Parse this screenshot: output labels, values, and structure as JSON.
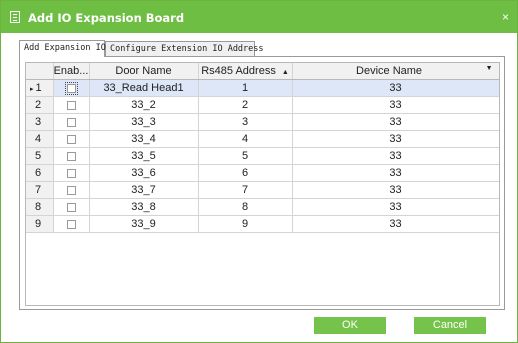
{
  "window": {
    "title": "Add IO Expansion Board",
    "close_label": "×"
  },
  "tabs": [
    {
      "label": "Add Expansion IO",
      "active": true
    },
    {
      "label": "Configure Extension IO Address",
      "active": false
    }
  ],
  "table": {
    "columns": [
      "Enab...",
      "Door Name",
      "Rs485 Address",
      "Device Name"
    ],
    "sort_indicator": "▲",
    "dropdown_indicator": "▼",
    "current_row_indicator": "▸",
    "rows": [
      {
        "num": "1",
        "door_name": "33_Read Head1",
        "address": "1",
        "device": "33",
        "checked": false
      },
      {
        "num": "2",
        "door_name": "33_2",
        "address": "2",
        "device": "33",
        "checked": false
      },
      {
        "num": "3",
        "door_name": "33_3",
        "address": "3",
        "device": "33",
        "checked": false
      },
      {
        "num": "4",
        "door_name": "33_4",
        "address": "4",
        "device": "33",
        "checked": false
      },
      {
        "num": "5",
        "door_name": "33_5",
        "address": "5",
        "device": "33",
        "checked": false
      },
      {
        "num": "6",
        "door_name": "33_6",
        "address": "6",
        "device": "33",
        "checked": false
      },
      {
        "num": "7",
        "door_name": "33_7",
        "address": "7",
        "device": "33",
        "checked": false
      },
      {
        "num": "8",
        "door_name": "33_8",
        "address": "8",
        "device": "33",
        "checked": false
      },
      {
        "num": "9",
        "door_name": "33_9",
        "address": "9",
        "device": "33",
        "checked": false
      }
    ]
  },
  "buttons": {
    "ok_label": "OK",
    "cancel_label": "Cancel"
  },
  "colors": {
    "accent": "#6fbe44",
    "button": "#75c34b",
    "selected_row": "#dde7f7"
  }
}
